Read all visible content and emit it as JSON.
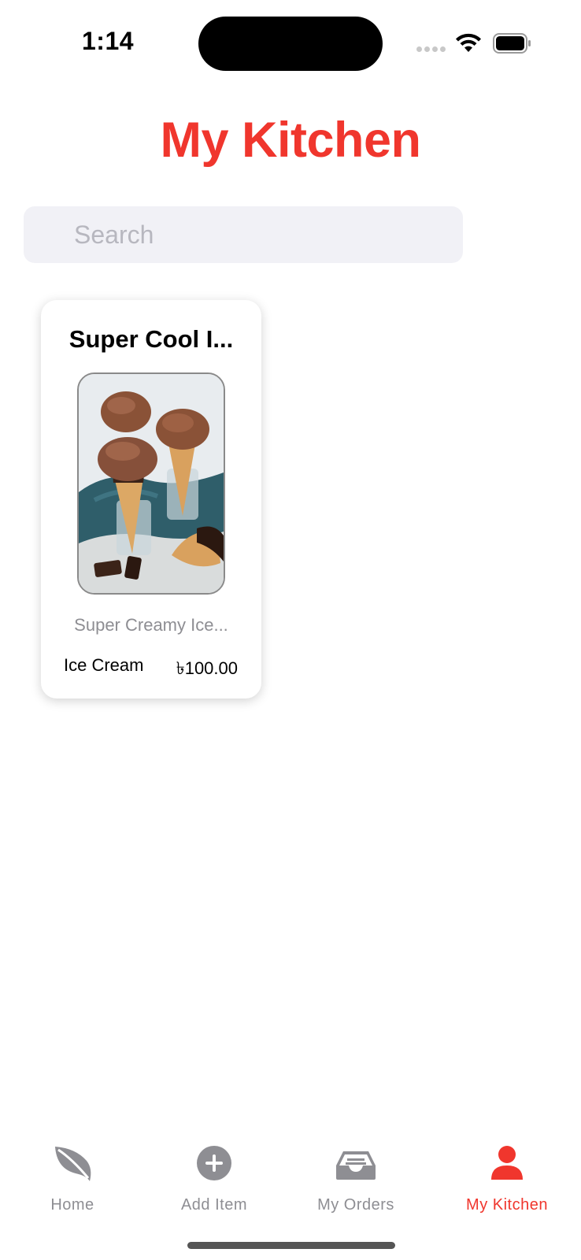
{
  "status_bar": {
    "time": "1:14"
  },
  "header": {
    "title": "My Kitchen"
  },
  "search": {
    "placeholder": "Search",
    "value": ""
  },
  "items": [
    {
      "title": "Super Cool I...",
      "image": "ice-cream-cones-photo",
      "description": "Super Creamy Ice...",
      "category": "Ice Cream",
      "price": "৳100.00"
    }
  ],
  "tab_bar": {
    "tabs": [
      {
        "label": "Home",
        "icon": "leaf-icon",
        "active": false
      },
      {
        "label": "Add Item",
        "icon": "plus-circle-icon",
        "active": false
      },
      {
        "label": "My Orders",
        "icon": "tray-icon",
        "active": false
      },
      {
        "label": "My Kitchen",
        "icon": "person-icon",
        "active": true
      }
    ]
  },
  "colors": {
    "accent": "#f0362d",
    "inactive_tab": "#8e8e93",
    "search_background": "#f1f1f6"
  }
}
